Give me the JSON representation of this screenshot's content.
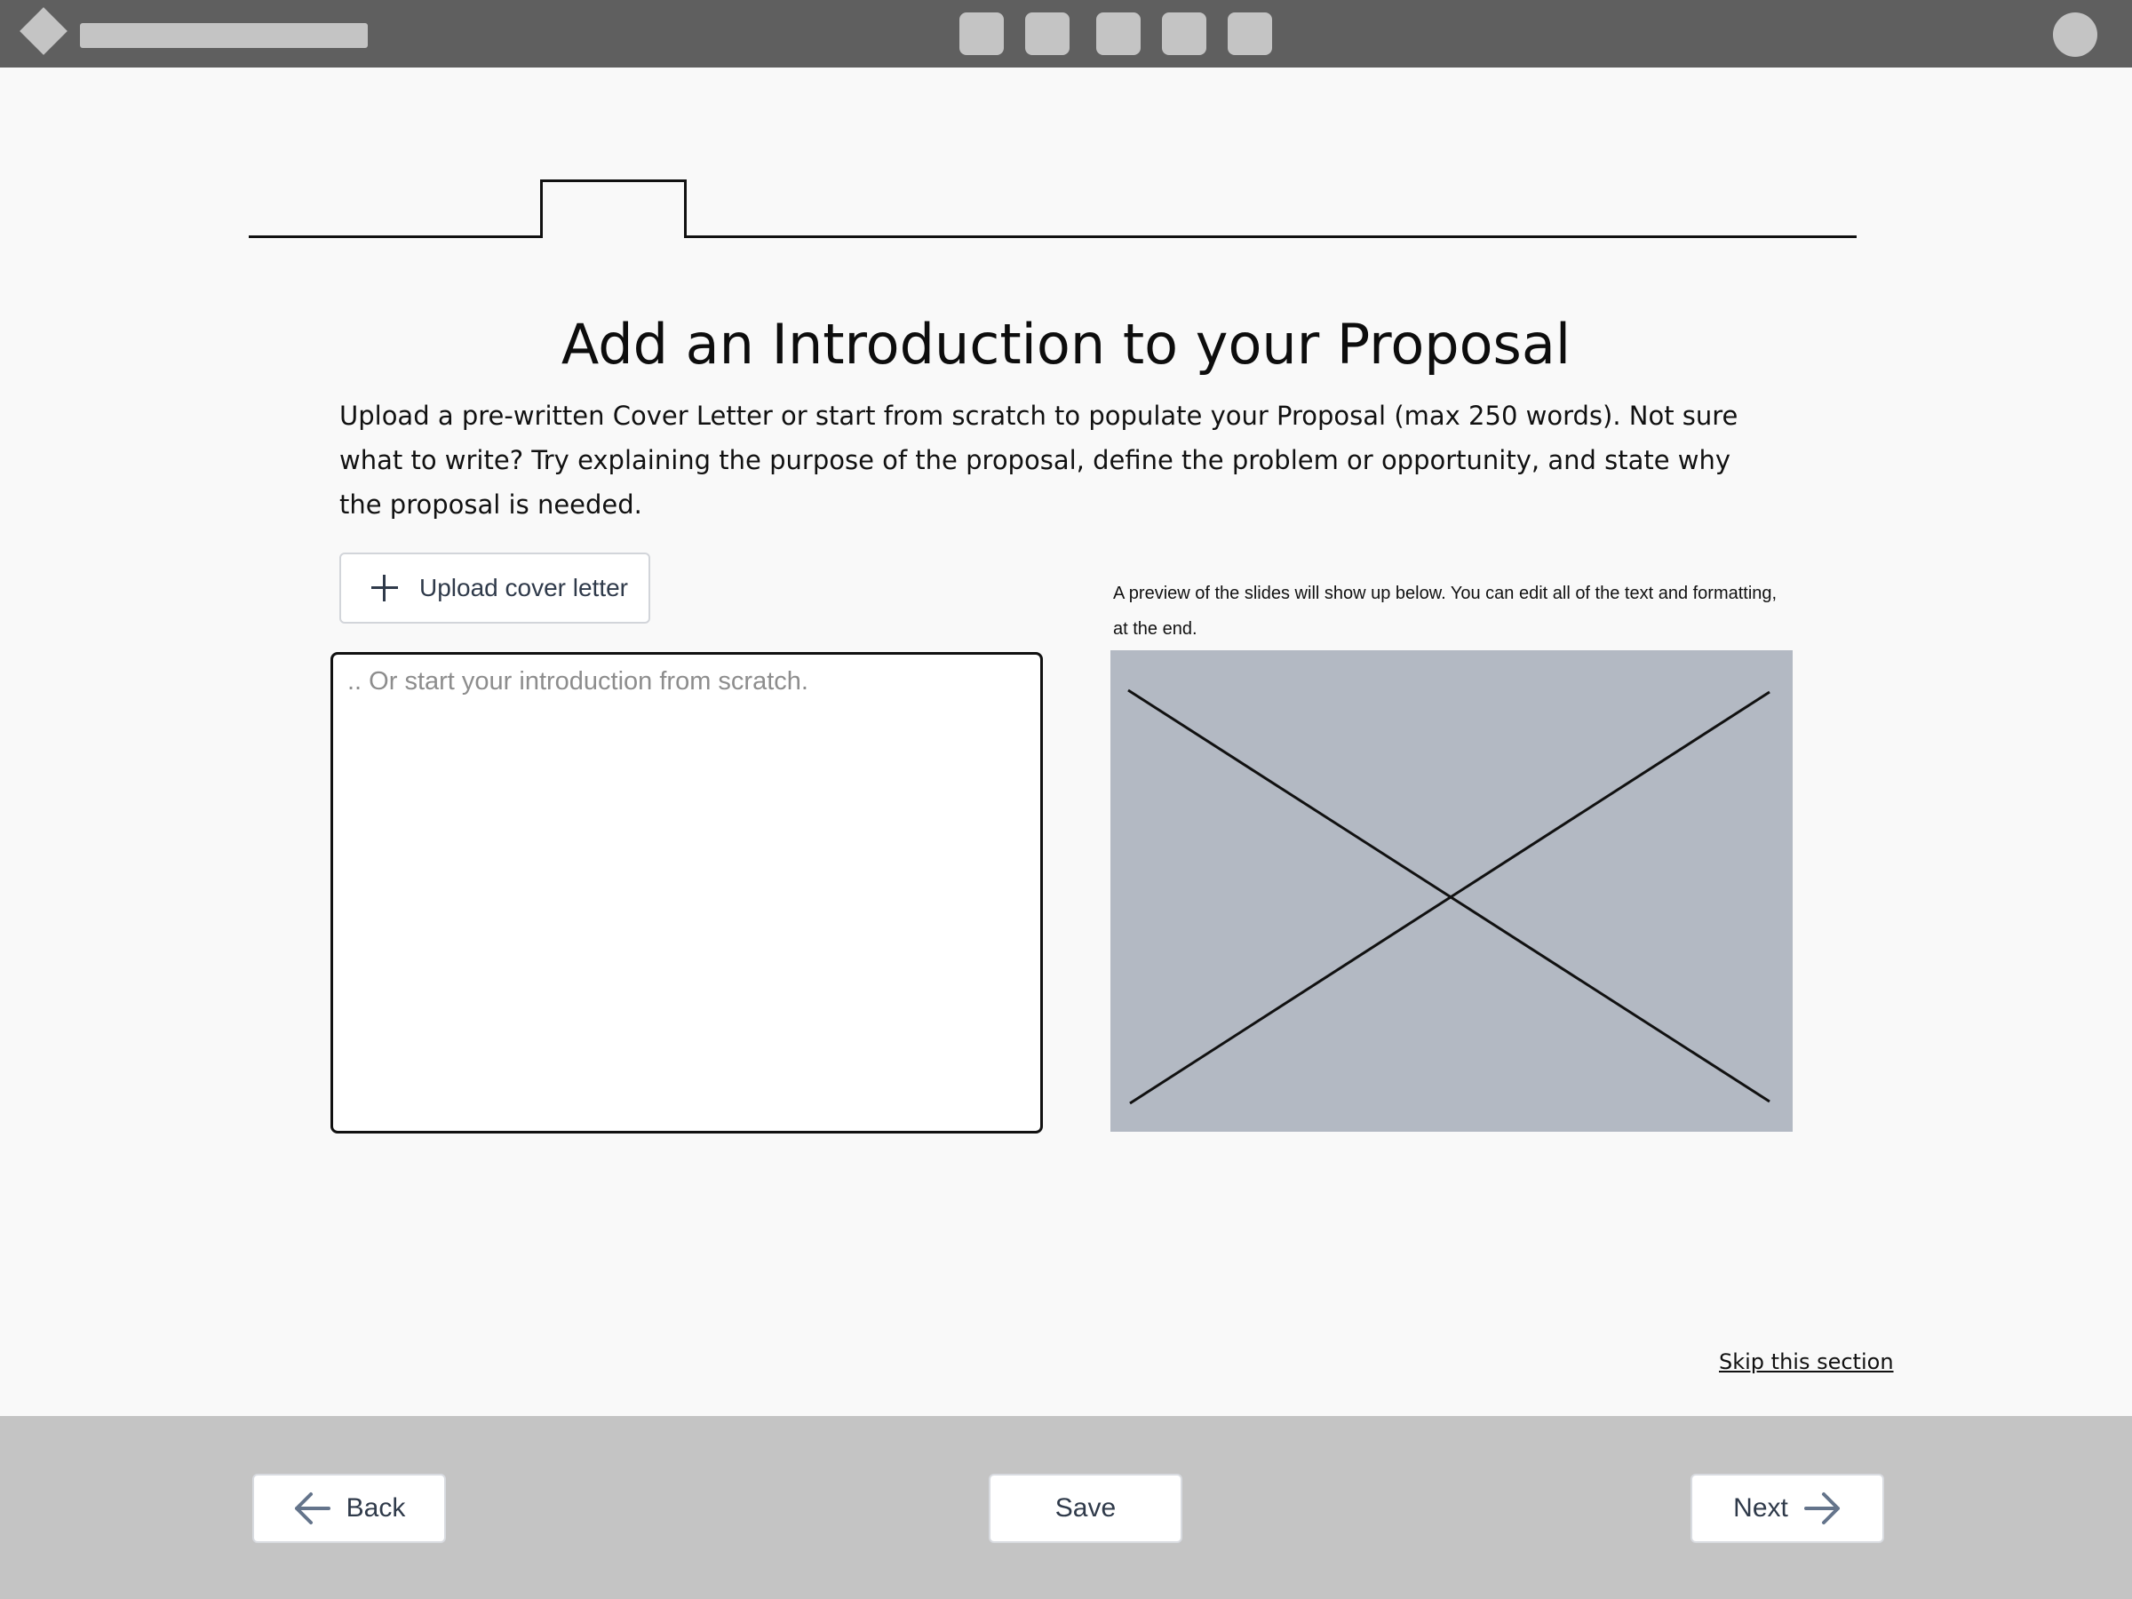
{
  "header": {
    "logo_icon": "diamond-logo-icon",
    "nav_icons": [
      "nav-icon-1",
      "nav-icon-2",
      "nav-icon-3",
      "nav-icon-4",
      "nav-icon-5"
    ],
    "avatar_icon": "user-avatar-icon"
  },
  "progress": {
    "active_step_icon": "step-marker-icon"
  },
  "main": {
    "title": "Add an Introduction to your Proposal",
    "description": "Upload a pre-written Cover Letter or start from scratch to populate your Proposal (max 250 words). Not sure what to write? Try explaining the purpose of the proposal, define the problem or opportunity, and state why the proposal is needed.",
    "upload_label": "Upload cover letter",
    "intro_placeholder": ".. Or start your introduction from scratch.",
    "intro_value": "",
    "preview_note": "A preview of the slides will show up below.  You can edit all of the text and formatting, at the end.",
    "preview_placeholder_icon": "image-placeholder-icon",
    "skip_label": "Skip this section"
  },
  "footer": {
    "back_label": "Back",
    "save_label": "Save",
    "next_label": "Next"
  },
  "colors": {
    "topbar": "#5f5f5f",
    "placeholder_gray": "#c4c4c4",
    "preview_bg": "#b3b9c3",
    "footer_bg": "#c4c4c4",
    "button_text": "#2f3a4a"
  }
}
